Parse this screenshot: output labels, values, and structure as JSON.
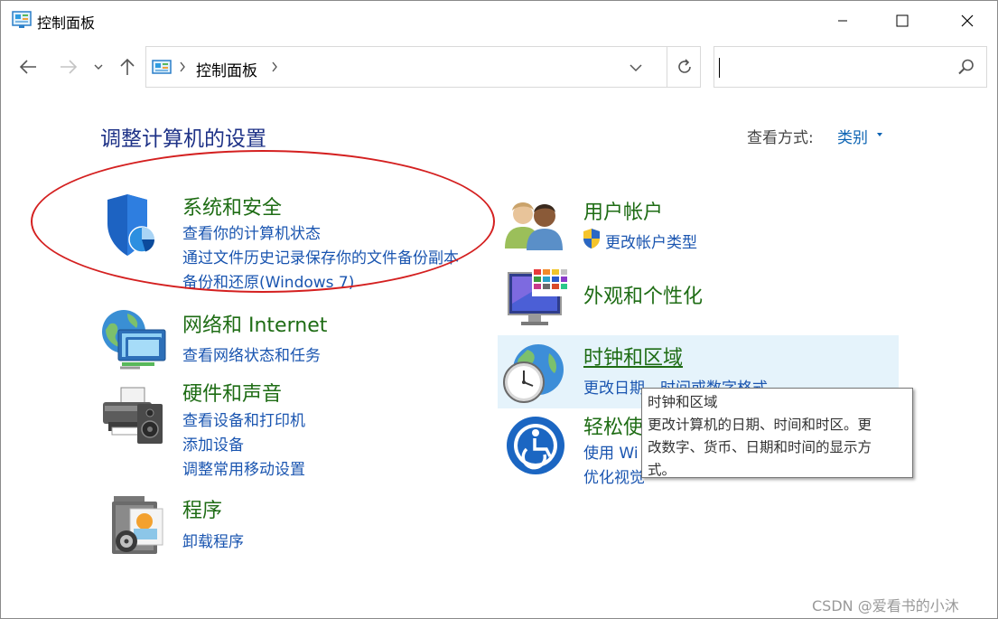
{
  "window": {
    "title": "控制面板"
  },
  "titlebar": {
    "minimize_icon": "minimize-icon",
    "maximize_icon": "maximize-icon",
    "close_icon": "close-icon"
  },
  "nav": {
    "back_icon": "arrow-left-icon",
    "forward_icon": "arrow-right-icon",
    "recent_icon": "chevron-down-icon",
    "up_icon": "arrow-up-icon"
  },
  "address": {
    "crumb": "控制面板",
    "refresh_icon": "refresh-icon",
    "dropdown_icon": "chevron-down-icon"
  },
  "search": {
    "value": "",
    "icon": "search-icon"
  },
  "main": {
    "heading": "调整计算机的设置",
    "view_by_label": "查看方式:",
    "view_by_value": "类别"
  },
  "categories": {
    "system_security": {
      "title": "系统和安全",
      "links": [
        "查看你的计算机状态",
        "通过文件历史记录保存你的文件备份副本",
        "备份和还原(Windows 7)"
      ]
    },
    "network": {
      "title": "网络和 Internet",
      "links": [
        "查看网络状态和任务"
      ]
    },
    "hardware": {
      "title": "硬件和声音",
      "links": [
        "查看设备和打印机",
        "添加设备",
        "调整常用移动设置"
      ]
    },
    "programs": {
      "title": "程序",
      "links": [
        "卸载程序"
      ]
    },
    "user_accounts": {
      "title": "用户帐户",
      "links": [
        "更改帐户类型"
      ]
    },
    "appearance": {
      "title": "外观和个性化",
      "links": []
    },
    "clock_region": {
      "title": "时钟和区域",
      "links": [
        "更改日期、时间或数字格式"
      ]
    },
    "ease_of_access": {
      "title": "轻松使",
      "links": [
        "使用 Wi",
        "优化视觉"
      ]
    }
  },
  "tooltip": {
    "lines": [
      "时钟和区域",
      "更改计算机的日期、时间和时区。更",
      "改数字、货币、日期和时间的显示方",
      "式。"
    ]
  },
  "watermark": "CSDN @爱看书的小沐",
  "colors": {
    "category_green": "#1e6c14",
    "link_blue": "#1a55b0",
    "heading_navy": "#1e3287",
    "hover_bg": "#e5f3fb",
    "annotation_red": "#d42020"
  }
}
